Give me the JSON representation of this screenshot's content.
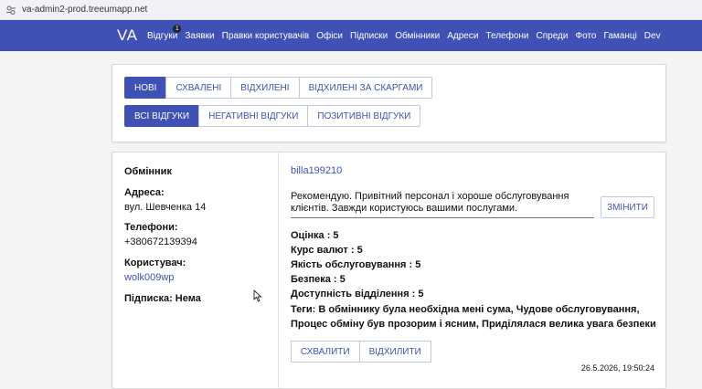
{
  "browser": {
    "url": "va-admin2-prod.treeumapp.net"
  },
  "nav": {
    "brand": "VA",
    "links": [
      "Відгуки",
      "Заявки",
      "Правки користувачів",
      "Офіси",
      "Підписки",
      "Обмінники",
      "Адреси",
      "Телефони",
      "Спреди",
      "Фото",
      "Гаманці",
      "Dev"
    ],
    "reviews_badge": "1"
  },
  "filters": {
    "status_tabs": [
      "НОВІ",
      "СХВАЛЕНІ",
      "ВІДХИЛЕНІ",
      "ВІДХИЛЕНІ ЗА СКАРГАМИ"
    ],
    "active_status": "НОВІ",
    "type_tabs": [
      "ВСІ ВІДГУКИ",
      "НЕГАТИВНІ ВІДГУКИ",
      "ПОЗИТИВНІ ВІДГУКИ"
    ],
    "active_type": "ВСІ ВІДГУКИ"
  },
  "review": {
    "exchanger_label": "Обмінник",
    "address_label": "Адреса:",
    "address": "вул. Шевченка 14",
    "phones_label": "Телефони:",
    "phone": "+380672139394",
    "user_label": "Користувач:",
    "user": "wolk009wp",
    "subscription": "Підписка: Нема",
    "author": "billa199210",
    "text": "Рекомендую. Привітний персонал і хороше обслуговування клієнтів. Завжди користуюсь вашими послугами.",
    "change_button": "ЗМІНИТИ",
    "ratings": [
      "Оцінка : 5",
      "Курс валют : 5",
      "Якість обслуговування : 5",
      "Безпека : 5",
      "Доступність відділення : 5"
    ],
    "tags": "Теги: В обміннику була необхідна мені сума, Чудове обслуговування, Процес обміну був прозорим і ясним, Приділялася велика увага безпеки",
    "approve_button": "СХВАЛИТИ",
    "reject_button": "ВІДХИЛИТИ",
    "timestamp": "26.5.2026, 19:50:24"
  },
  "colors": {
    "primary": "#3f51b5",
    "background": "#f4f4f4"
  }
}
